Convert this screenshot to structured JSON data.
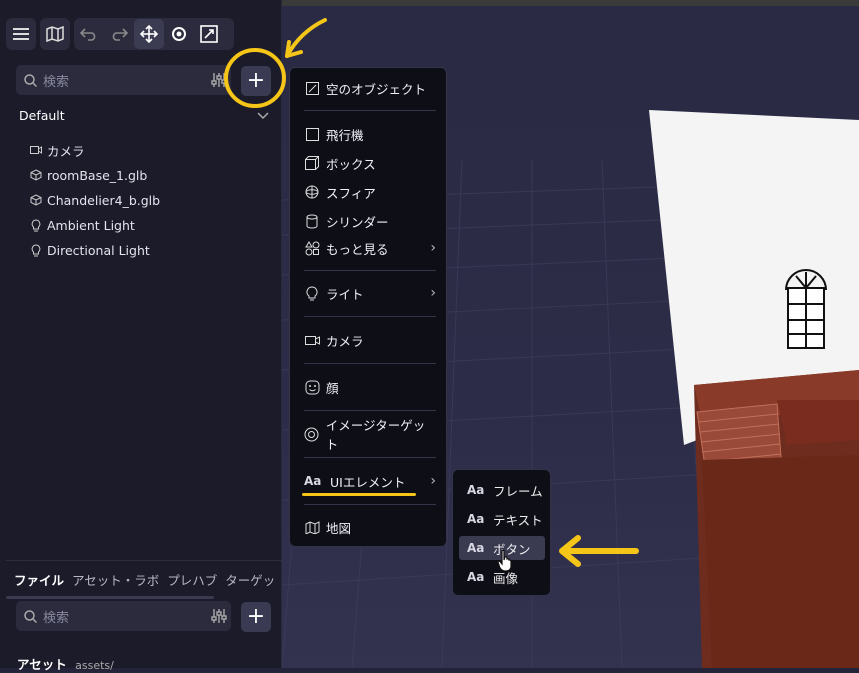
{
  "toolbar": {
    "icons": [
      "menu-icon",
      "map-icon",
      "undo-icon",
      "redo-icon",
      "move-icon",
      "orbit-icon",
      "scale-icon"
    ]
  },
  "hierarchy": {
    "search_placeholder": "検索",
    "scene_name": "Default",
    "items": [
      {
        "label": "カメラ",
        "icon": "camera-icon"
      },
      {
        "label": "roomBase_1.glb",
        "icon": "cube-icon"
      },
      {
        "label": "Chandelier4_b.glb",
        "icon": "cube-icon"
      },
      {
        "label": "Ambient Light",
        "icon": "bulb-icon"
      },
      {
        "label": "Directional Light",
        "icon": "bulb-icon"
      }
    ],
    "add_label": "+"
  },
  "bottom": {
    "tabs": [
      "ファイル",
      "アセット・ラボ",
      "プレハブ",
      "ターゲッ"
    ],
    "search_placeholder": "検索",
    "add_label": "+",
    "assets_label": "アセット",
    "assets_path": "assets/"
  },
  "menu": {
    "empty_object": "空のオブジェクト",
    "plane": "飛行機",
    "box": "ボックス",
    "sphere": "スフィア",
    "cylinder": "シリンダー",
    "more": "もっと見る",
    "light": "ライト",
    "camera": "カメラ",
    "face": "顔",
    "image_target": "イメージターゲット",
    "ui_element": "UIエレメント",
    "map": "地図",
    "aa": "Aa"
  },
  "submenu": {
    "aa": "Aa",
    "items": [
      "フレーム",
      "テキスト",
      "ボタン",
      "画像"
    ],
    "highlighted": "ボタン"
  },
  "colors": {
    "annotation": "#f5c518",
    "panel": "#1b1b2a",
    "menu": "#0e0e17"
  }
}
